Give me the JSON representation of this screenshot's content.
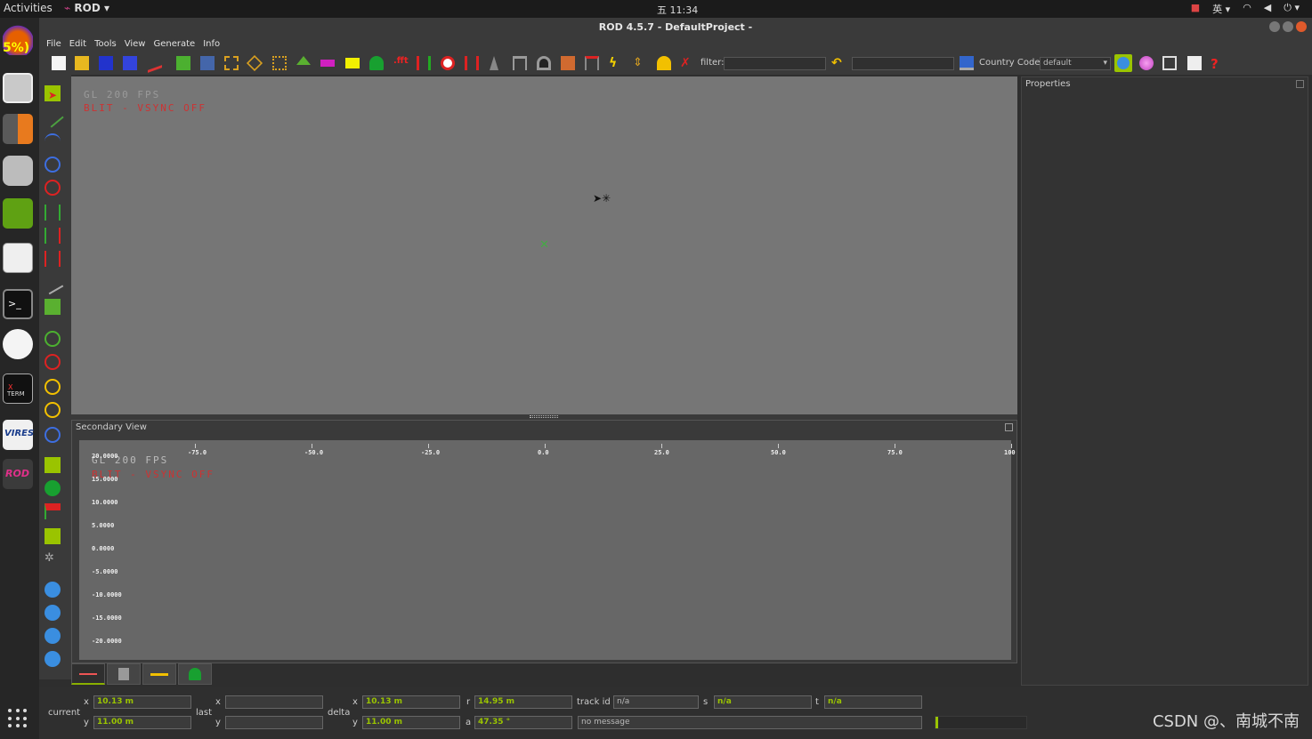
{
  "topbar": {
    "activities": "Activities",
    "app_name": "ROD",
    "clock": "五 11:34",
    "input_method": "英"
  },
  "window": {
    "title": "ROD 4.5.7 - DefaultProject -"
  },
  "menu": [
    "File",
    "Edit",
    "Tools",
    "View",
    "Generate",
    "Info"
  ],
  "toolbar": {
    "filter_label": "filter:",
    "filter_value": "",
    "search_value": "",
    "country_label": "Country Code:",
    "country_value": "default"
  },
  "dock": {
    "battery_text": "5%)"
  },
  "main_view": {
    "fps_line1": "GL 200 FPS",
    "fps_line2": "BLIT - VSYNC OFF"
  },
  "secondary_view": {
    "title": "Secondary View",
    "fps_line1": "GL 200 FPS",
    "fps_line2": "BLIT - VSYNC OFF",
    "x_ticks": [
      "-75.0",
      "-50.0",
      "-25.0",
      "0.0",
      "25.0",
      "50.0",
      "75.0",
      "100"
    ],
    "y_ticks": [
      "20.0000",
      "15.0000",
      "10.0000",
      "5.0000",
      "0.0000",
      "-5.0000",
      "-10.0000",
      "-15.0000",
      "-20.0000"
    ]
  },
  "properties": {
    "title": "Properties"
  },
  "status": {
    "current_label": "current",
    "last_label": "last",
    "delta_label": "delta",
    "x_label": "x",
    "y_label": "y",
    "r_label": "r",
    "a_label": "a",
    "s_label": "s",
    "t_label": "t",
    "track_id_label": "track id",
    "current_x": "10.13 m",
    "current_y": "11.00 m",
    "last_x": "",
    "last_y": "",
    "delta_x": "10.13 m",
    "delta_y": "11.00 m",
    "r_value": "14.95 m",
    "a_value": "47.35 °",
    "track_id_value": "n/a",
    "s_value": "n/a",
    "t_value": "n/a",
    "message": "no message"
  },
  "watermark": "CSDN @、南城不南"
}
